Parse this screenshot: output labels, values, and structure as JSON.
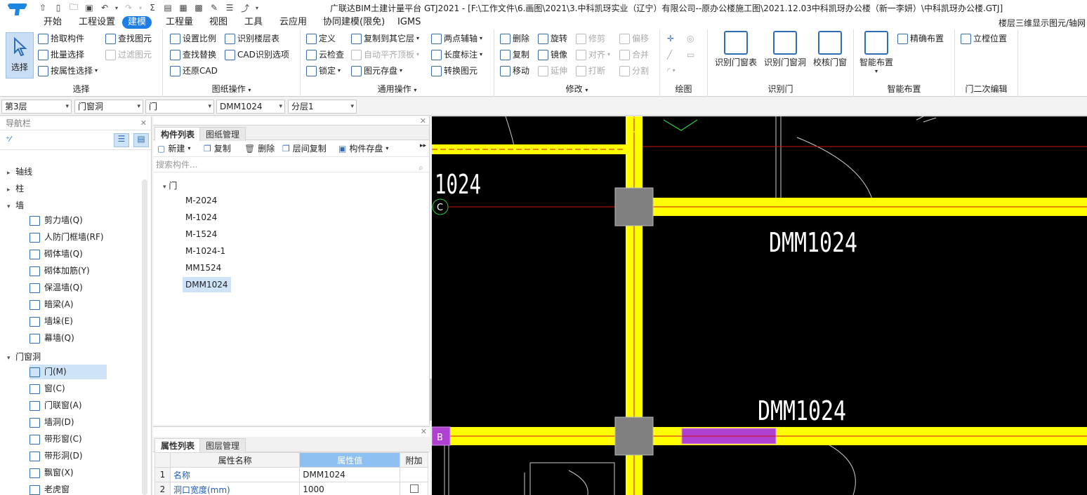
{
  "title_bar": {
    "app_title": "广联达BIM土建计量平台 GTJ2021 - [F:\\工作文件\\6.画图\\2021\\3.中科凯玡实业（辽宁）有限公司--原办公楼施工图\\2021.12.03中科凯玡办公楼（新一李妍）\\中科凯玡办公楼.GTJ]"
  },
  "menu": {
    "tabs": [
      "开始",
      "工程设置",
      "建模",
      "工程量",
      "视图",
      "工具",
      "云应用",
      "协同建模(限免)",
      "IGMS"
    ],
    "active_tab": "建模",
    "right_hint": "楼层三维显示图元/轴网"
  },
  "ribbon": {
    "select_group": {
      "label": "选择",
      "big_button": "选择",
      "buttons": [
        "拾取构件",
        "批量选择",
        "按属性选择",
        "查找图元",
        "过滤图元"
      ]
    },
    "drawing_ops": {
      "label": "图纸操作",
      "buttons": [
        "设置比例",
        "查找替换",
        "还原CAD",
        "识别楼层表",
        "CAD识别选项"
      ]
    },
    "common_ops": {
      "label": "通用操作",
      "buttons": [
        "定义",
        "云检查",
        "锁定",
        "复制到其它层",
        "自动平齐顶板",
        "图元存盘",
        "两点辅轴",
        "长度标注",
        "转换图元"
      ]
    },
    "modify": {
      "label": "修改",
      "buttons": [
        "删除",
        "复制",
        "移动",
        "旋转",
        "镜像",
        "延伸",
        "修剪",
        "对齐",
        "打断",
        "偏移",
        "合并",
        "分割"
      ]
    },
    "draw": {
      "label": "绘图"
    },
    "recognize_door": {
      "label": "识别门",
      "buttons": [
        "识别门窗表",
        "识别门窗洞",
        "校核门窗"
      ]
    },
    "smart_layout": {
      "label": "智能布置",
      "buttons": [
        "智能布置",
        "精确布置"
      ]
    },
    "door_edit": {
      "label": "门二次编辑",
      "buttons": [
        "立樘位置"
      ]
    }
  },
  "combos": {
    "floor": "第3层",
    "category": "门窗洞",
    "type": "门",
    "component": "DMM1024",
    "layer": "分层1"
  },
  "nav": {
    "title": "导航栏",
    "tree": [
      {
        "label": "轴线",
        "expanded": false
      },
      {
        "label": "柱",
        "expanded": false
      },
      {
        "label": "墙",
        "expanded": true
      }
    ],
    "wall_items": [
      "剪力墙(Q)",
      "人防门框墙(RF)",
      "砌体墙(Q)",
      "砌体加筋(Y)",
      "保温墙(Q)",
      "暗梁(A)",
      "墙垛(E)",
      "幕墙(Q)"
    ],
    "door_window_group": "门窗洞",
    "door_window_items": [
      "门(M)",
      "窗(C)",
      "门联窗(A)",
      "墙洞(D)",
      "带形窗(C)",
      "带形洞(D)",
      "飘窗(X)",
      "老虎窗"
    ],
    "selected_item": "门(M)"
  },
  "component_panel": {
    "tabs": [
      "构件列表",
      "图纸管理"
    ],
    "toolbar": [
      "新建",
      "复制",
      "删除",
      "层间复制",
      "构件存盘"
    ],
    "search_placeholder": "搜索构件...",
    "group": "门",
    "items": [
      "M-2024",
      "M-1024",
      "M-1524",
      "M-1024-1",
      "MM1524",
      "DMM1024"
    ],
    "selected": "DMM1024"
  },
  "property_panel": {
    "tabs": [
      "属性列表",
      "图层管理"
    ],
    "headers": [
      "属性名称",
      "属性值",
      "附加"
    ],
    "rows": [
      {
        "idx": "1",
        "name": "名称",
        "value": "DMM1024"
      },
      {
        "idx": "2",
        "name": "洞口宽度(mm)",
        "value": "1000"
      }
    ]
  },
  "canvas": {
    "labels": [
      "1024",
      "DMM1024",
      "DMM1024"
    ],
    "axis_markers": [
      "C",
      "B"
    ],
    "colors": {
      "background": "#000000",
      "wall": "#ffff00",
      "axis": "#d01010",
      "column": "#808080",
      "door": "#b040d0"
    }
  }
}
